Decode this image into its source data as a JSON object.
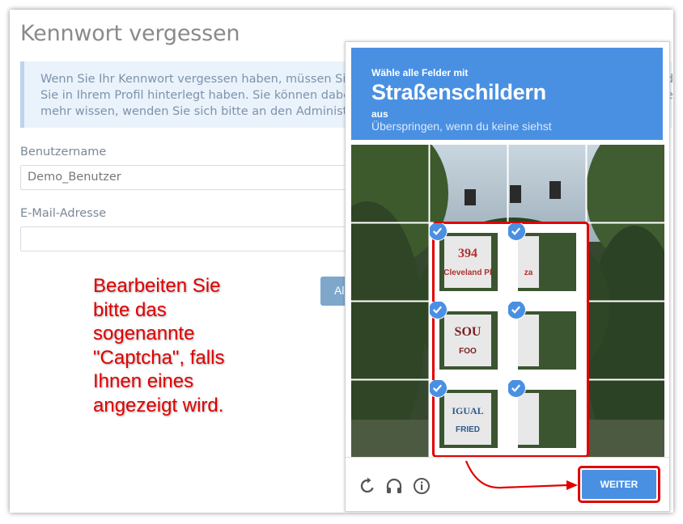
{
  "page": {
    "title": "Kennwort vergessen",
    "info_lines": [
      "Wenn Sie Ihr Kennwort vergessen haben, müssen Sie entw",
      "Sie in Ihrem Profil hinterlegt haben. Sie können dabei nur",
      "mehr wissen, wenden Sie sich bitte an den Administrator."
    ],
    "info_right": [
      "d",
      "e"
    ],
    "username_label": "Benutzername",
    "username_value": "Demo_Benutzer",
    "email_label": "E-Mail-Adresse",
    "email_value": "",
    "partial_button": "Al"
  },
  "annotation": {
    "lines": [
      "Bearbeiten Sie",
      "bitte das",
      "sogenannte",
      "\"Captcha\", falls",
      "Ihnen eines",
      "angezeigt wird."
    ],
    "color": "#e00000"
  },
  "captcha": {
    "line1": "Wähle alle Felder mit",
    "line2": "Straßenschildern",
    "line3": "aus",
    "line4": "Überspringen, wenn du keine siehst",
    "button": "WEITER",
    "accent": "#4a90e2",
    "tiles_selected": [
      [
        false,
        false,
        false,
        false
      ],
      [
        false,
        true,
        true,
        false
      ],
      [
        false,
        true,
        true,
        false
      ],
      [
        false,
        true,
        true,
        false
      ]
    ],
    "footer_icons": [
      "reload-icon",
      "headphones-icon",
      "info-icon"
    ]
  }
}
